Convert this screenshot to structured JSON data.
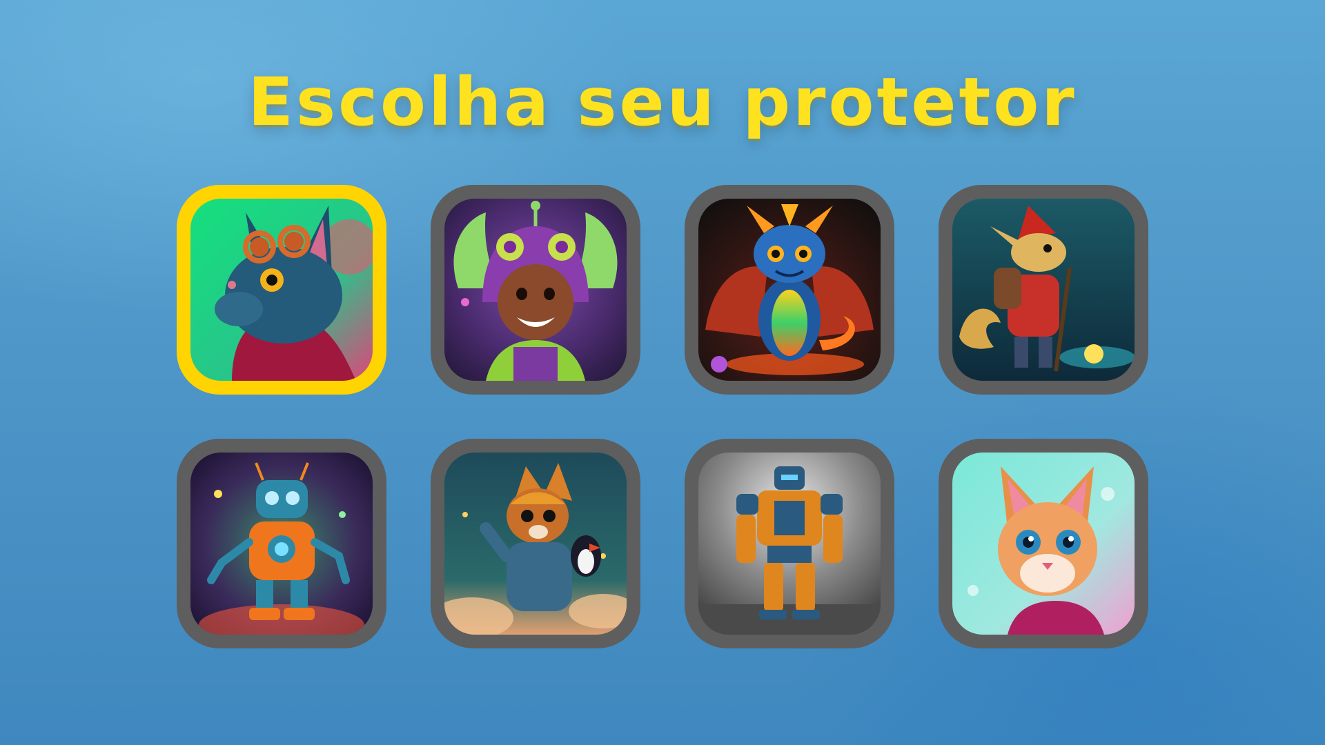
{
  "screen": {
    "title": "Escolha seu protetor",
    "selected_index": 0
  },
  "colors": {
    "selected_border": "#ffd400",
    "default_border": "#5e5e5e",
    "title": "#ffe21f"
  },
  "characters": [
    {
      "id": "blue-cat-goggles",
      "icon": "blue-cat-with-goggles"
    },
    {
      "id": "alien-kid",
      "icon": "purple-alien-costume-kid"
    },
    {
      "id": "rainbow-dragon",
      "icon": "baby-dragon"
    },
    {
      "id": "gnome-fox",
      "icon": "fox-explorer-with-red-hat"
    },
    {
      "id": "orange-robot",
      "icon": "retro-robot"
    },
    {
      "id": "fox-astronaut",
      "icon": "fox-with-penguin"
    },
    {
      "id": "mech-robot",
      "icon": "mech-robot"
    },
    {
      "id": "orange-kitten",
      "icon": "orange-kitten"
    }
  ]
}
